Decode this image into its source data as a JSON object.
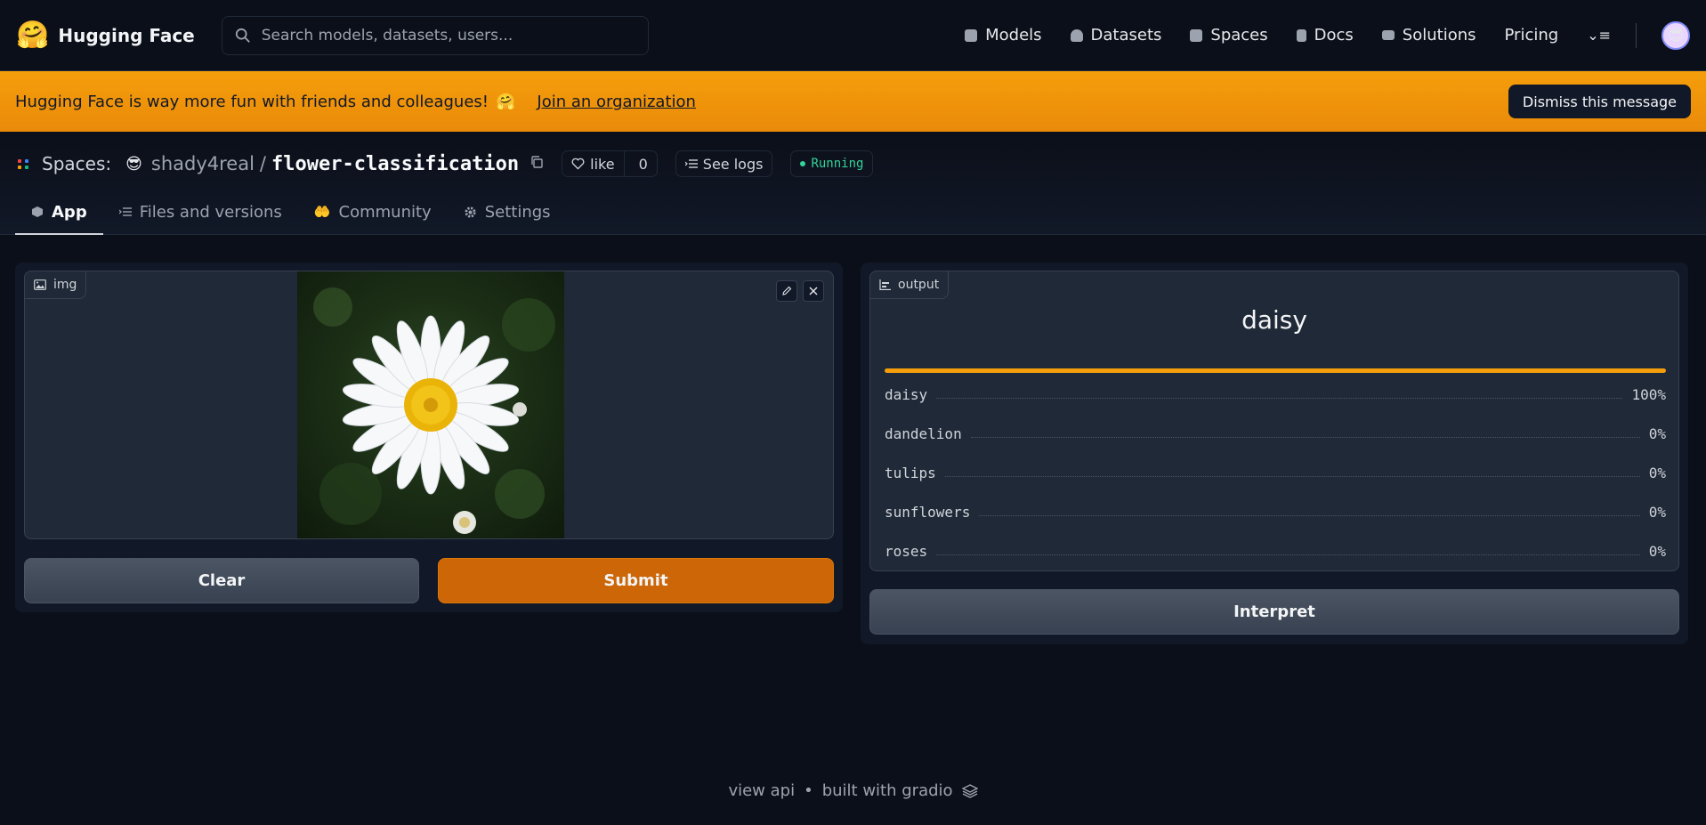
{
  "nav": {
    "brand": "Hugging Face",
    "brand_emoji": "🤗",
    "search_placeholder": "Search models, datasets, users...",
    "links": [
      "Models",
      "Datasets",
      "Spaces",
      "Docs",
      "Solutions",
      "Pricing"
    ],
    "more": "⌄≡",
    "avatar_emoji": "😎"
  },
  "banner": {
    "text": "Hugging Face is way more fun with friends and colleagues!",
    "emoji": "🤗",
    "link": "Join an organization",
    "dismiss": "Dismiss this message"
  },
  "space": {
    "label": "Spaces:",
    "owner_emoji": "😎",
    "owner": "shady4real",
    "separator": "/",
    "repo": "flower-classification",
    "like_label": "like",
    "like_count": "0",
    "logs_label": "See logs",
    "status": "Running",
    "tabs": [
      "App",
      "Files and versions",
      "Community",
      "Settings"
    ],
    "community_emoji": "🤲"
  },
  "input": {
    "label": "img",
    "clear": "Clear",
    "submit": "Submit"
  },
  "output": {
    "label": "output",
    "title": "daisy",
    "top_confidence": 1.0,
    "confidences": [
      {
        "name": "daisy",
        "value": "100%"
      },
      {
        "name": "dandelion",
        "value": "0%"
      },
      {
        "name": "tulips",
        "value": "0%"
      },
      {
        "name": "sunflowers",
        "value": "0%"
      },
      {
        "name": "roses",
        "value": "0%"
      }
    ],
    "interpret": "Interpret"
  },
  "footer": {
    "api": "view api",
    "bullet": "•",
    "built": "built with gradio"
  },
  "colors": {
    "accent": "#f59e0b",
    "primary_button": "#cc6607",
    "running": "#34d399"
  }
}
